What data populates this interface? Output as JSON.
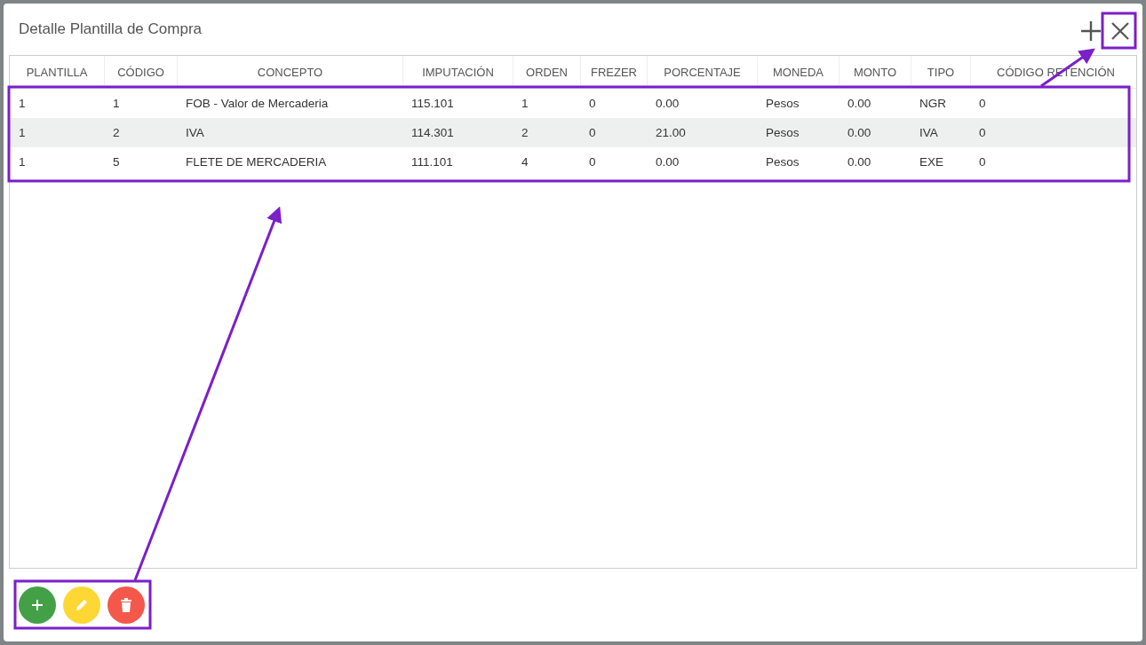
{
  "dialog": {
    "title": "Detalle Plantilla de Compra"
  },
  "table": {
    "columns": [
      "PLANTILLA",
      "CÓDIGO",
      "CONCEPTO",
      "IMPUTACIÓN",
      "ORDEN",
      "FREZER",
      "PORCENTAJE",
      "MONEDA",
      "MONTO",
      "TIPO",
      "CÓDIGO RETENCIÓN"
    ],
    "rows": [
      [
        "1",
        "1",
        "FOB - Valor de Mercaderia",
        "115.101",
        "1",
        "0",
        "0.00",
        "Pesos",
        "0.00",
        "NGR",
        "0"
      ],
      [
        "1",
        "2",
        "IVA",
        "114.301",
        "2",
        "0",
        "21.00",
        "Pesos",
        "0.00",
        "IVA",
        "0"
      ],
      [
        "1",
        "5",
        "FLETE DE MERCADERIA",
        "111.101",
        "4",
        "0",
        "0.00",
        "Pesos",
        "0.00",
        "EXE",
        "0"
      ]
    ]
  }
}
